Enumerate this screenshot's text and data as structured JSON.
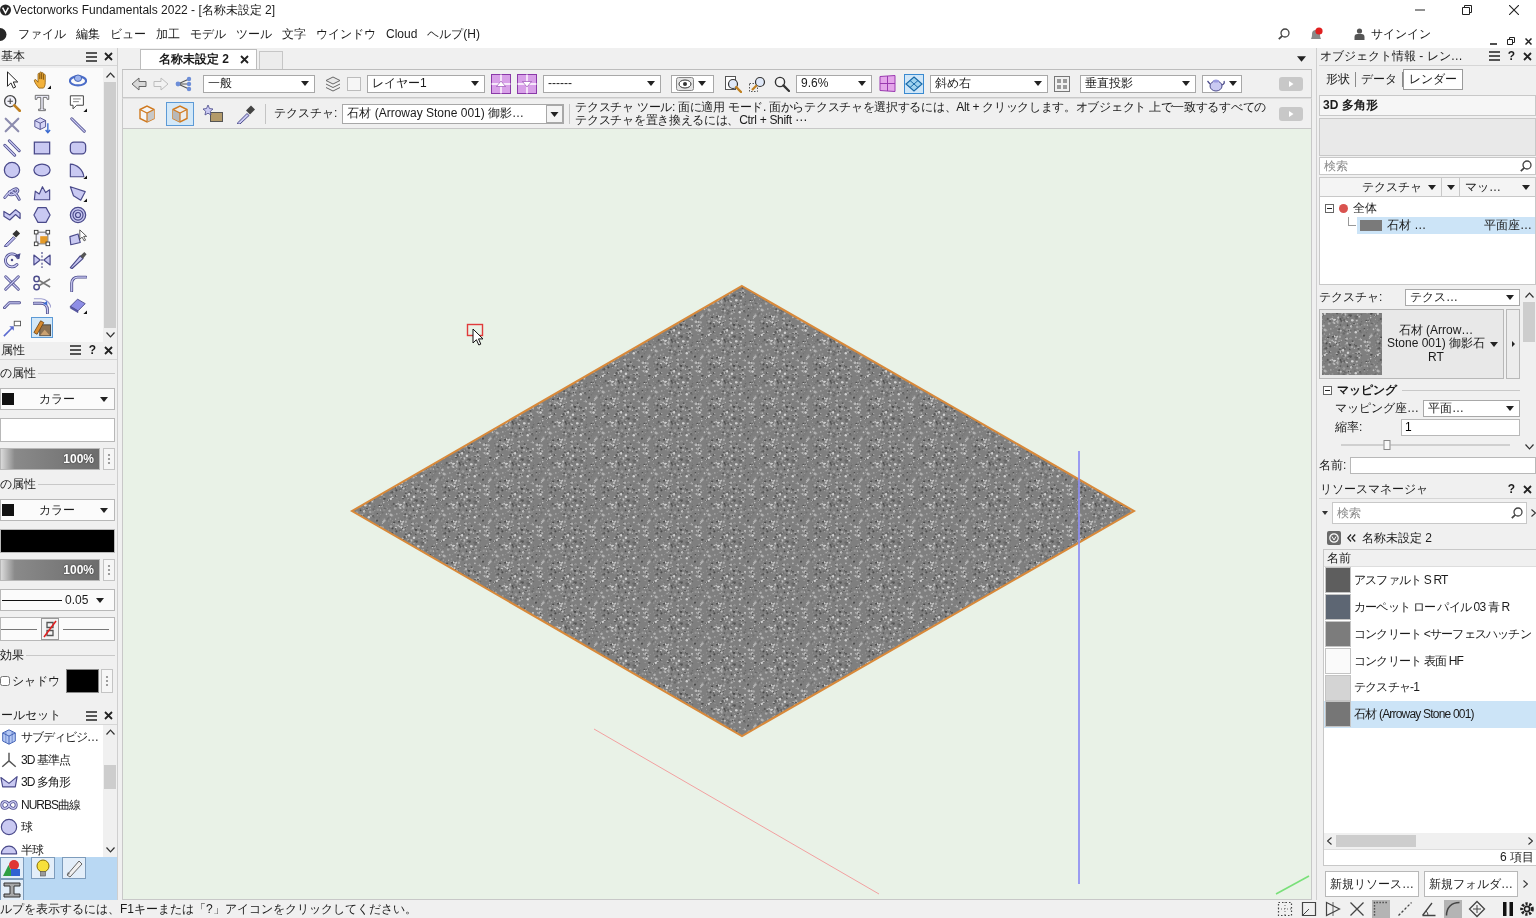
{
  "window": {
    "title": "Vectorworks Fundamentals 2022 - [名称未設定 2]"
  },
  "menu_bar": {
    "items": [
      "ファイル",
      "編集",
      "ビュー",
      "加工",
      "モデル",
      "ツール",
      "文字",
      "ウインドウ",
      "Cloud",
      "ヘルプ(H)"
    ],
    "sign_in": "サインイン"
  },
  "tool_palette": {
    "title": "基本",
    "tools": [
      {
        "selected": false
      },
      {
        "selected": false
      },
      {
        "selected": false
      },
      {
        "selected": false
      },
      {
        "selected": false
      },
      {
        "selected": false
      },
      {
        "selected": false
      },
      {
        "selected": false
      },
      {
        "selected": false
      },
      {
        "selected": false
      },
      {
        "selected": false
      },
      {
        "selected": false
      },
      {
        "selected": false
      },
      {
        "selected": false
      },
      {
        "selected": false
      },
      {
        "selected": false
      },
      {
        "selected": false
      },
      {
        "selected": false
      },
      {
        "selected": false
      },
      {
        "selected": false
      },
      {
        "selected": false
      },
      {
        "selected": false
      },
      {
        "selected": false
      },
      {
        "selected": false
      },
      {
        "selected": false
      },
      {
        "selected": false
      },
      {
        "selected": false
      },
      {
        "selected": false
      },
      {
        "selected": false
      },
      {
        "selected": false
      },
      {
        "selected": false
      },
      {
        "selected": false
      },
      {
        "selected": false
      },
      {
        "selected": false
      },
      {
        "selected": true
      }
    ]
  },
  "attributes": {
    "title": "属性",
    "help_button": "?",
    "fill": {
      "heading": "の属性",
      "type": "カラー",
      "opacity": {
        "reading": "100%",
        "level": 1
      }
    },
    "pen": {
      "heading": "の属性",
      "type": "カラー",
      "opacity": {
        "reading": "100%",
        "level": 1
      },
      "weight": "0.05"
    },
    "effects": {
      "heading": "効果",
      "shadow": {
        "label": "シャドウ",
        "checked": false
      }
    }
  },
  "tool_sets": {
    "title": "ールセット",
    "items": [
      {
        "label": "サブディビジ…"
      },
      {
        "label": "3D 基準点"
      },
      {
        "label": "3D 多角形"
      },
      {
        "label": "NURBS曲線"
      },
      {
        "label": "球"
      },
      {
        "label": "半球"
      }
    ]
  },
  "document": {
    "tabs": [
      {
        "label": "名称未設定 2",
        "selected": true
      }
    ]
  },
  "view_bar": {
    "class": "一般",
    "layer": "レイヤー1",
    "dropdown_3": "------",
    "zoom": "9.6%",
    "plane_toggles": [
      {
        "selected": false
      },
      {
        "selected": true
      }
    ],
    "view": "斜め右",
    "projection": "垂直投影"
  },
  "mode_bar": {
    "modes": [
      {
        "selected": false
      },
      {
        "selected": true
      },
      {
        "selected": false
      },
      {
        "selected": false
      }
    ],
    "texture_label": "テクスチャ:",
    "texture": "石材 (Arroway Stone 001) 御影…",
    "help": "テクスチャ ツール: 面に適用 モード. 面からテクスチャを選択するには、Alt + クリックします。オブジェクト 上で一致するすべてのテクスチャを置き換えるには、Ctrl + Shift ⋯"
  },
  "object_info": {
    "title": "オブジェクト情報 - レン…",
    "help_button": "?",
    "tabs": [
      {
        "label": "形状",
        "selected": false
      },
      {
        "label": "データ",
        "selected": false
      },
      {
        "label": "レンダー",
        "selected": true
      }
    ],
    "object_type": "3D 多角形",
    "search_placeholder": "検索",
    "columns": [
      "テクスチャ",
      "マッ…"
    ],
    "tree": [
      {
        "label": "全体",
        "expanded": true,
        "selected": false,
        "children": [
          {
            "label": "石材 …",
            "column_3": "平面座…",
            "selected": true
          }
        ]
      }
    ],
    "texture_label": "テクスチャ:",
    "texture_source": "テクス…",
    "texture_name": "石材 (Arrow… Stone 001) 御影石 RT",
    "mapping": {
      "heading": "マッピング",
      "expanded": true,
      "method_label": "マッピング座…",
      "method": "平面…",
      "scale_label": "縮率:",
      "scale": "1",
      "scale_slider": {
        "level": 0.27
      }
    },
    "name_label": "名前:"
  },
  "resource_manager": {
    "title": "リソースマネージャ",
    "help_button": "?",
    "search_placeholder": "検索",
    "file": "名称未設定 2",
    "column": "名前",
    "items": [
      {
        "label": "アスファルト S RT",
        "color": "#5e5e5e",
        "selected": false
      },
      {
        "label": "カーペット ロー パイル 03 青 R",
        "color": "#5d6673",
        "selected": false
      },
      {
        "label": "コンクリート <サーフェスハッチン",
        "color": "#7c7c7c",
        "selected": false
      },
      {
        "label": "コンクリート 表面 HF",
        "color": "#fafafa",
        "selected": false
      },
      {
        "label": "テクスチャ-1",
        "color": "#d4d4d4",
        "selected": false
      },
      {
        "label": "石材 (Arroway Stone 001)",
        "color": "#767676",
        "selected": true
      }
    ],
    "count": "6 項目",
    "buttons": [
      "新規リソース…",
      "新規フォルダ…"
    ]
  },
  "status_bar": {
    "help": "ルプを表示するには、F1キーまたは「?」アイコンをクリックしてください。",
    "snaps": [
      {
        "selected": false
      },
      {
        "selected": false
      },
      {
        "selected": false
      },
      {
        "selected": false
      },
      {
        "selected": true
      },
      {
        "selected": false
      },
      {
        "selected": false
      },
      {
        "selected": true
      },
      {
        "selected": false
      }
    ]
  }
}
